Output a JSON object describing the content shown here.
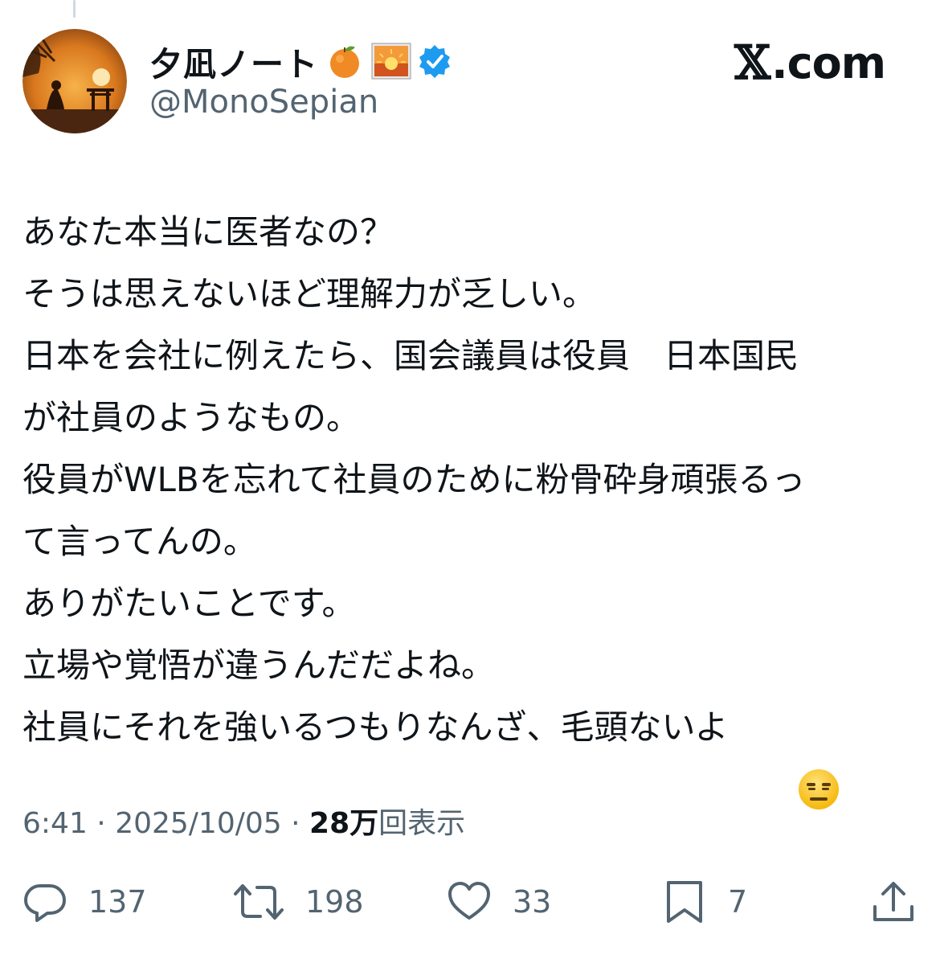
{
  "post": {
    "author": {
      "display_name": "夕凪ノート",
      "handle": "@MonoSepian",
      "name_emojis": [
        "orange-emoji",
        "sunrise-emoji"
      ],
      "verified_color": "#1d9bf0"
    },
    "brand": {
      "label": ".com"
    },
    "body_lines": [
      "あなた本当に医者なの？",
      "そうは思えないほど理解力が乏しい。",
      "日本を会社に例えたら、国会議員は役員　日本国民",
      "が社員のようなもの。",
      "役員がWLBを忘れて社員のために粉骨砕身頑張るっ",
      "て言ってんの。",
      "ありがたいことです。",
      "立場や覚悟が違うんだだよね。",
      "社員にそれを強いるつもりなんざ、毛頭ないよ"
    ],
    "trailing_emoji": "expressionless-face-emoji",
    "meta": {
      "time": "6:41",
      "separator": " · ",
      "date": "2025/10/05",
      "views_number": "28",
      "views_unit": "万",
      "views_label": "回表示"
    },
    "actions": {
      "replies": "137",
      "reposts": "198",
      "likes": "33",
      "bookmarks": "7"
    },
    "colors": {
      "text": "#0f1419",
      "secondary": "#536471",
      "verified": "#1d9bf0"
    }
  }
}
